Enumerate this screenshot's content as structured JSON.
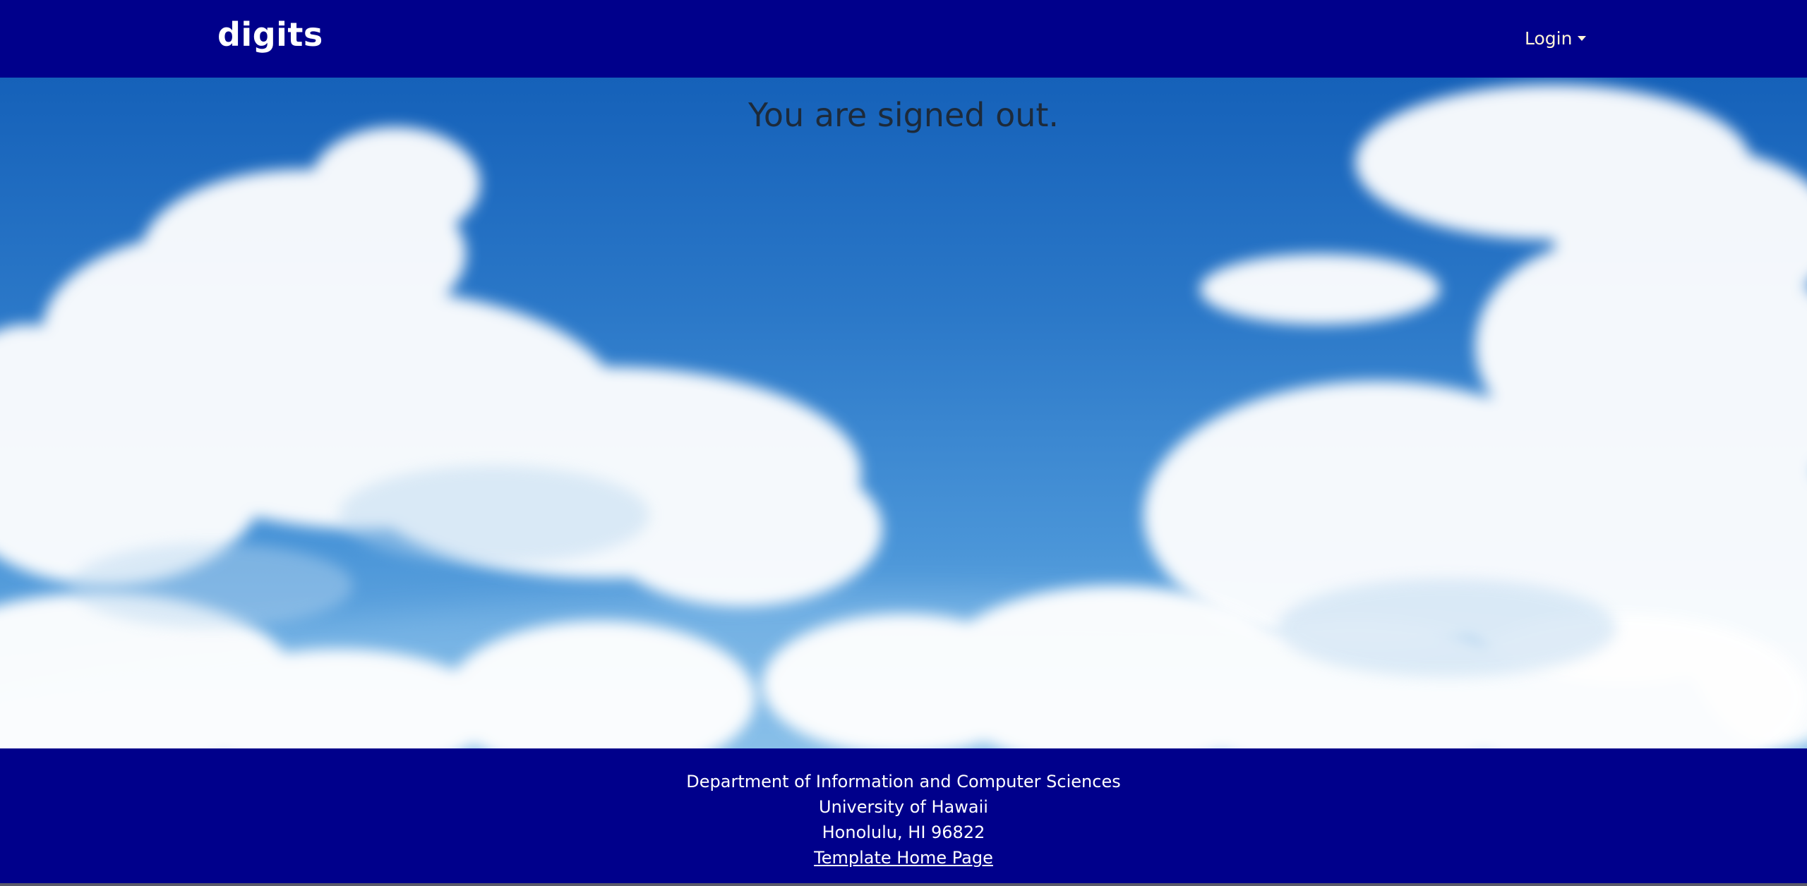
{
  "navbar": {
    "brand": "digits",
    "login_label": "Login"
  },
  "main": {
    "message": "You are signed out."
  },
  "footer": {
    "line1": "Department of Information and Computer Sciences",
    "line2": "University of Hawaii",
    "line3": "Honolulu, HI 96822",
    "link_label": "Template Home Page"
  },
  "colors": {
    "navbar_bg": "#00008b",
    "footer_bg": "#00008b",
    "sky_top": "#1561b9",
    "sky_bottom": "#7cb8e6",
    "cloud": "#ffffff"
  }
}
